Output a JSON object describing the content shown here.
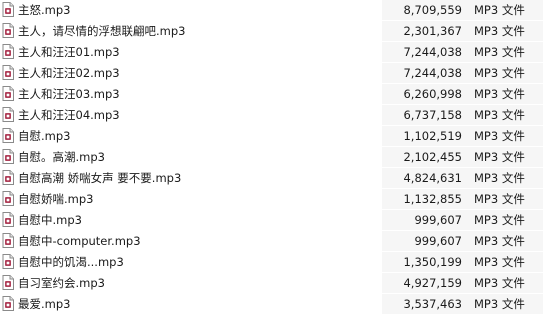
{
  "files": [
    {
      "name": "主怒.mp3",
      "size": "8,709,559",
      "type": "MP3 文件",
      "icon": "audio-file-icon"
    },
    {
      "name": "主人，请尽情的浮想联翩吧.mp3",
      "size": "2,301,367",
      "type": "MP3 文件",
      "icon": "audio-file-icon"
    },
    {
      "name": "主人和汪汪01.mp3",
      "size": "7,244,038",
      "type": "MP3 文件",
      "icon": "audio-file-icon"
    },
    {
      "name": "主人和汪汪02.mp3",
      "size": "7,244,038",
      "type": "MP3 文件",
      "icon": "audio-file-icon"
    },
    {
      "name": "主人和汪汪03.mp3",
      "size": "6,260,998",
      "type": "MP3 文件",
      "icon": "audio-file-icon"
    },
    {
      "name": "主人和汪汪04.mp3",
      "size": "6,737,158",
      "type": "MP3 文件",
      "icon": "audio-file-icon"
    },
    {
      "name": "自慰.mp3",
      "size": "1,102,519",
      "type": "MP3 文件",
      "icon": "audio-file-icon"
    },
    {
      "name": "自慰。高潮.mp3",
      "size": "2,102,455",
      "type": "MP3 文件",
      "icon": "audio-file-icon"
    },
    {
      "name": "自慰高潮 娇喘女声 要不要.mp3",
      "size": "4,824,631",
      "type": "MP3 文件",
      "icon": "audio-file-icon"
    },
    {
      "name": "自慰娇喘.mp3",
      "size": "1,132,855",
      "type": "MP3 文件",
      "icon": "audio-file-icon"
    },
    {
      "name": "自慰中.mp3",
      "size": "999,607",
      "type": "MP3 文件",
      "icon": "audio-file-icon"
    },
    {
      "name": "自慰中-computer.mp3",
      "size": "999,607",
      "type": "MP3 文件",
      "icon": "audio-file-icon"
    },
    {
      "name": "自慰中的饥渴...mp3",
      "size": "1,350,199",
      "type": "MP3 文件",
      "icon": "audio-file-icon"
    },
    {
      "name": "自习室约会.mp3",
      "size": "4,927,159",
      "type": "MP3 文件",
      "icon": "audio-file-icon"
    },
    {
      "name": "最爱.mp3",
      "size": "3,537,463",
      "type": "MP3 文件",
      "icon": "audio-file-icon"
    }
  ],
  "colors": {
    "row_bg": "#ffffff",
    "column_bg": "#f6f6f6",
    "text": "#1a1a1a",
    "icon_accent": "#b0405a"
  }
}
